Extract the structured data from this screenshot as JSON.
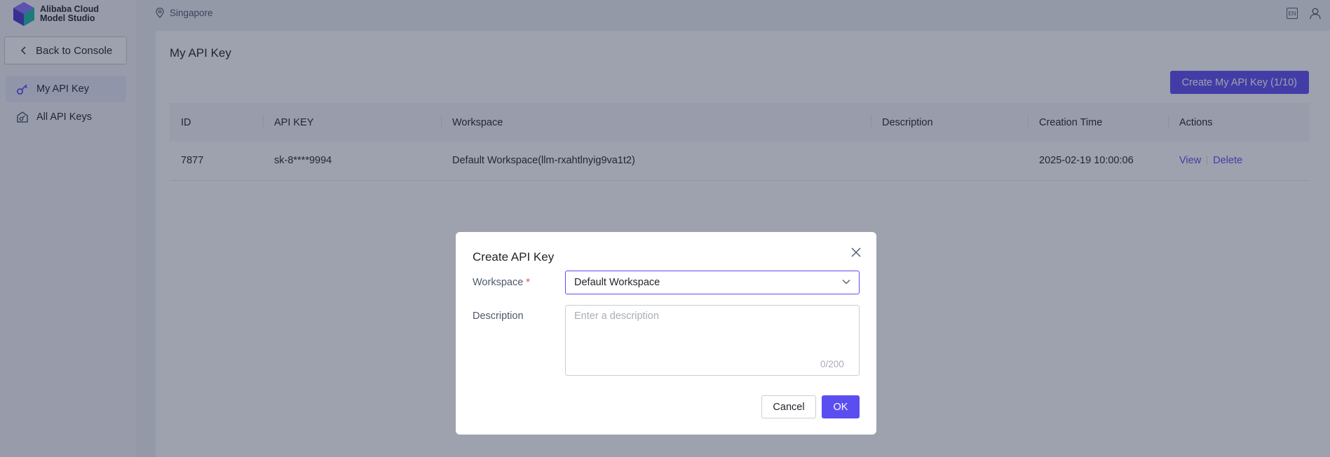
{
  "brand": {
    "line1": "Alibaba Cloud",
    "line2": "Model Studio"
  },
  "sidebar": {
    "back_label": "Back to Console",
    "items": [
      {
        "label": "My API Key",
        "icon": "key-icon",
        "active": true
      },
      {
        "label": "All API Keys",
        "icon": "key-house-icon",
        "active": false
      }
    ]
  },
  "topbar": {
    "region": "Singapore",
    "lang": "EN"
  },
  "main": {
    "title": "My API Key",
    "create_button": "Create My API Key (1/10)",
    "table": {
      "headers": [
        "ID",
        "API KEY",
        "Workspace",
        "Description",
        "Creation Time",
        "Actions"
      ],
      "rows": [
        {
          "id": "7877",
          "api_key": "sk-8****9994",
          "workspace": "Default Workspace(llm-rxahtlnyig9va1t2)",
          "description": "",
          "creation_time": "2025-02-19 10:00:06",
          "action_view": "View",
          "action_delete": "Delete"
        }
      ]
    }
  },
  "modal": {
    "title": "Create API Key",
    "workspace_label": "Workspace",
    "required_mark": "*",
    "workspace_value": "Default Workspace",
    "description_label": "Description",
    "description_placeholder": "Enter a description",
    "description_value": "",
    "counter": "0/200",
    "cancel_label": "Cancel",
    "ok_label": "OK"
  },
  "colors": {
    "accent": "#5b4ef0",
    "required": "#e5484d"
  }
}
